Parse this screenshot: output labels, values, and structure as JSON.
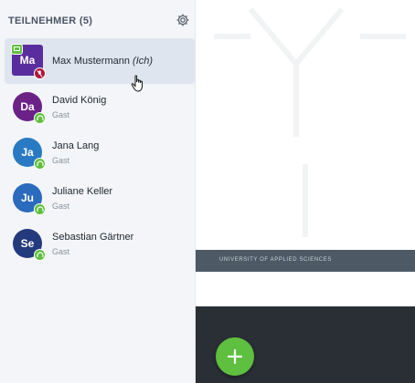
{
  "sidebar": {
    "title": "TEILNEHMER (5)",
    "settings_icon": "gear-icon",
    "participants": [
      {
        "initials": "Ma",
        "name": "Max Mustermann",
        "suffix": "(Ich)",
        "role": "",
        "avatar_color": "#5a2d9e",
        "status": "mic-muted",
        "presenter": true
      },
      {
        "initials": "Da",
        "name": "David König",
        "suffix": "",
        "role": "Gast",
        "avatar_color": "#6b2287",
        "status": "listening"
      },
      {
        "initials": "Ja",
        "name": "Jana Lang",
        "suffix": "",
        "role": "Gast",
        "avatar_color": "#2a7ac3",
        "status": "listening"
      },
      {
        "initials": "Ju",
        "name": "Juliane Keller",
        "suffix": "",
        "role": "Gast",
        "avatar_color": "#2a6bbd",
        "status": "listening"
      },
      {
        "initials": "Se",
        "name": "Sebastian Gärtner",
        "suffix": "",
        "role": "Gast",
        "avatar_color": "#233a7d",
        "status": "listening"
      }
    ]
  },
  "presentation": {
    "footer_text": "UNIVERSITY OF APPLIED SCIENCES"
  },
  "actions": {
    "add_icon": "plus-icon"
  },
  "colors": {
    "accent_green": "#5fbf3f",
    "muted_red": "#b0183b",
    "active_row": "#dfe5ef",
    "dark_panel": "#2a2f36"
  }
}
